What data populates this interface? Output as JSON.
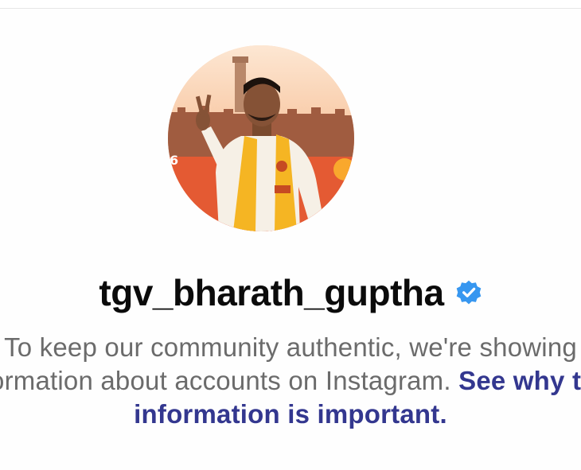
{
  "profile": {
    "username": "tgv_bharath_guptha",
    "verified_icon": "verified-badge-icon",
    "avatar_alt": "profile-photo"
  },
  "notice": {
    "line1": "To keep our community authentic, we're showing",
    "line2_text": "information about accounts on Instagram. ",
    "line2_link": "See why this",
    "line3_link": "information is important."
  },
  "colors": {
    "link": "#33378f",
    "text_muted": "#6b6b6b",
    "verified": "#3797f0",
    "username": "#0b0b0b"
  }
}
